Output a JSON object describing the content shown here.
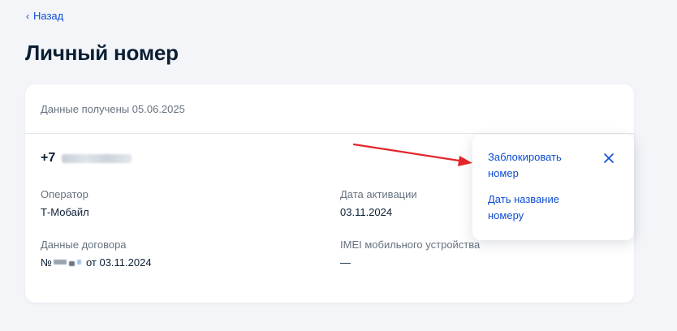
{
  "nav": {
    "back_label": "Назад",
    "back_icon": "chevron-left-icon"
  },
  "page": {
    "title": "Личный номер"
  },
  "card": {
    "header_text": "Данные получены 05.06.2025",
    "phone_prefix": "+7",
    "operator_label": "Оператор",
    "operator_value": "Т-Мобайл",
    "activation_label": "Дата активации",
    "activation_value": "03.11.2024",
    "contract_label": "Данные договора",
    "contract_prefix": "№",
    "contract_suffix": "от 03.11.2024",
    "imei_label": "IMEI мобильного устройства",
    "imei_value": "—"
  },
  "menu": {
    "block_number_label": "Заблокировать номер",
    "rename_number_label": "Дать название номеру",
    "close_icon": "close-icon"
  },
  "colors": {
    "page_background": "#f3f5f9",
    "card_background": "#ffffff",
    "text_primary": "#0b1f33",
    "text_secondary": "#66727f",
    "link_blue": "#0d4cd3",
    "annotation_red": "#e3262b"
  }
}
